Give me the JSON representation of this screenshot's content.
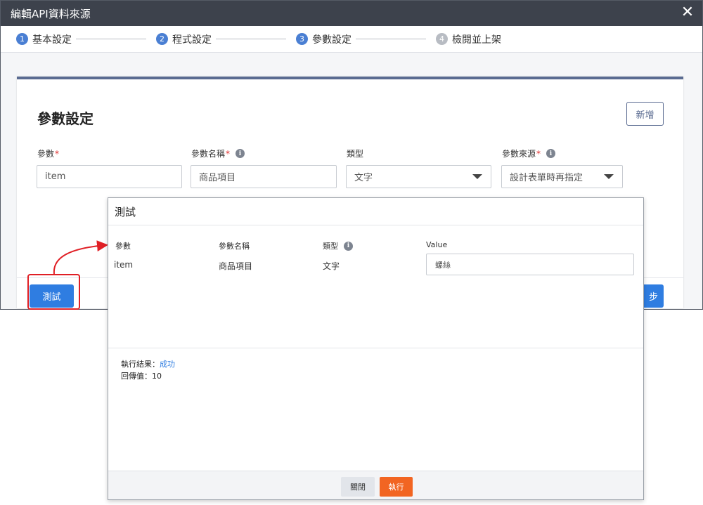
{
  "window": {
    "title": "編輯API資料來源",
    "close_glyph": "✕"
  },
  "steps": [
    {
      "num": "1",
      "label": "基本設定"
    },
    {
      "num": "2",
      "label": "程式設定"
    },
    {
      "num": "3",
      "label": "參數設定"
    },
    {
      "num": "4",
      "label": "檢閱並上架"
    }
  ],
  "card": {
    "title": "參數設定",
    "add_label": "新增",
    "fields": {
      "param": {
        "label": "參數",
        "value": "item"
      },
      "param_name": {
        "label": "參數名稱",
        "value": "商品項目"
      },
      "type": {
        "label": "類型",
        "value": "文字"
      },
      "source": {
        "label": "參數來源",
        "value": "設計表單時再指定"
      }
    },
    "required_mark": "*",
    "test_label": "測試",
    "next_label_fragment": "步"
  },
  "modal": {
    "title": "測試",
    "columns": {
      "param": "參數",
      "param_name": "參數名稱",
      "type": "類型",
      "value": "Value"
    },
    "row": {
      "param": "item",
      "param_name": "商品項目",
      "type": "文字",
      "value": "螺絲"
    },
    "result_label": "執行結果：",
    "result_value": "成功",
    "return_label": "回傳值：",
    "return_value": "10",
    "close_label": "關閉",
    "run_label": "執行"
  },
  "colors": {
    "accent": "#2f7de1",
    "run": "#f26522",
    "highlight": "#e01f25",
    "titlebar": "#3d424c"
  },
  "icons": {
    "info": "i"
  }
}
